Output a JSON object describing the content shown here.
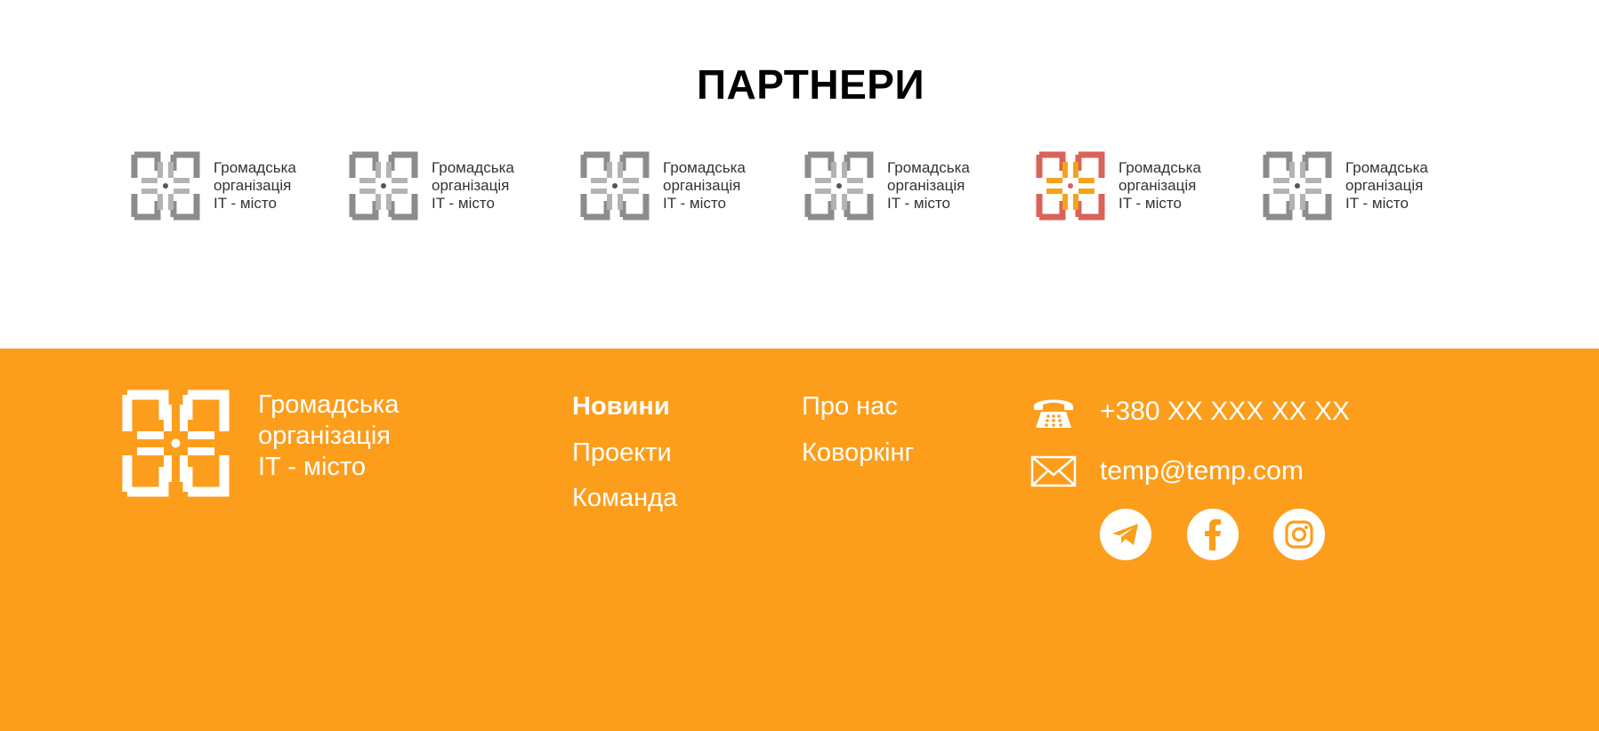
{
  "partners": {
    "title": "ПАРТНЕРИ",
    "logos": [
      {
        "line1": "Громадська",
        "line2": "організація",
        "line3": "IT - місто",
        "variant": "grey"
      },
      {
        "line1": "Громадська",
        "line2": "організація",
        "line3": "IT - місто",
        "variant": "grey"
      },
      {
        "line1": "Громадська",
        "line2": "організація",
        "line3": "IT - місто",
        "variant": "grey"
      },
      {
        "line1": "Громадська",
        "line2": "організація",
        "line3": "IT - місто",
        "variant": "grey"
      },
      {
        "line1": "Громадська",
        "line2": "організація",
        "line3": "IT - місто",
        "variant": "color"
      },
      {
        "line1": "Громадська",
        "line2": "організація",
        "line3": "IT - місто",
        "variant": "grey"
      }
    ]
  },
  "footer": {
    "logo": {
      "line1": "Громадська",
      "line2": "організація",
      "line3": "IT - місто"
    },
    "nav": {
      "news": "Новини",
      "projects": "Проекти",
      "team": "Команда",
      "about": "Про нас",
      "coworking": "Коворкінг"
    },
    "contacts": {
      "phone": "+380 XX XXX XX XX",
      "email": "temp@temp.com"
    },
    "social_icons": [
      "telegram-icon",
      "facebook-icon",
      "instagram-icon"
    ]
  },
  "colors": {
    "footer_bg": "#fc9e1c",
    "logo_grey": "#8c8c8c",
    "logo_red": "#d9625b",
    "logo_orange": "#f7a21b"
  }
}
